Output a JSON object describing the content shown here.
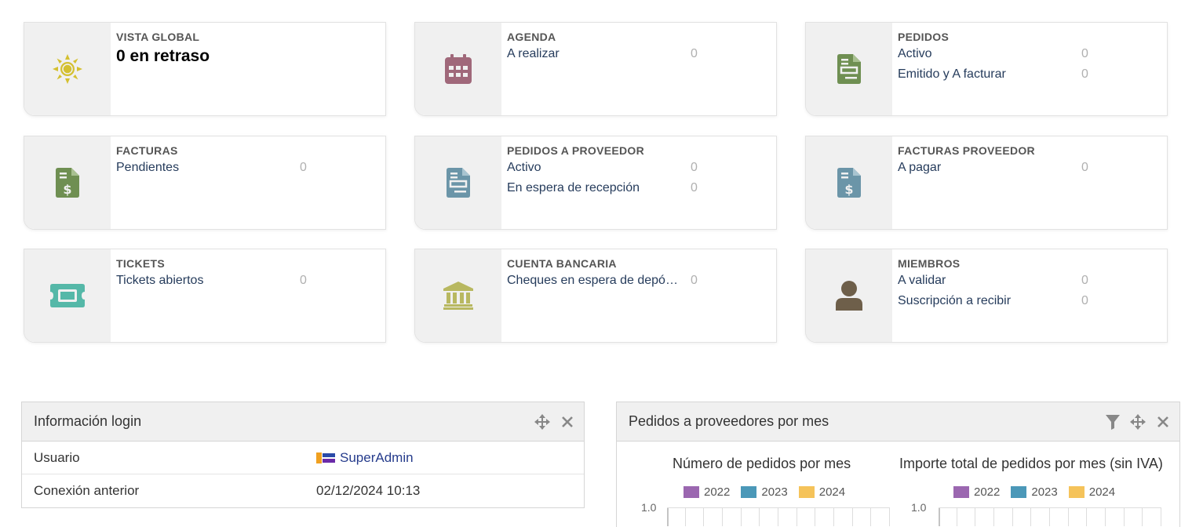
{
  "boxes": [
    {
      "title": "VISTA GLOBAL",
      "big": "0 en retraso",
      "icon": "sun-icon",
      "color": "#d4c030",
      "lines": []
    },
    {
      "title": "AGENDA",
      "icon": "calendar-icon",
      "color": "#a0687a",
      "lines": [
        {
          "label": "A realizar",
          "value": "0"
        }
      ]
    },
    {
      "title": "PEDIDOS",
      "icon": "order-document-icon",
      "color": "#6f8f52",
      "lines": [
        {
          "label": "Activo",
          "value": "0"
        },
        {
          "label": "Emitido y A facturar",
          "value": "0"
        }
      ]
    },
    {
      "title": "FACTURAS",
      "icon": "invoice-dollar-icon",
      "color": "#6f8f52",
      "lines": [
        {
          "label": "Pendientes",
          "value": "0"
        }
      ]
    },
    {
      "title": "PEDIDOS A PROVEEDOR",
      "icon": "supplier-order-document-icon",
      "color": "#6b95a8",
      "lines": [
        {
          "label": "Activo",
          "value": "0"
        },
        {
          "label": "En espera de recepción",
          "value": "0"
        }
      ]
    },
    {
      "title": "FACTURAS PROVEEDOR",
      "icon": "supplier-invoice-dollar-icon",
      "color": "#6b95a8",
      "lines": [
        {
          "label": "A pagar",
          "value": "0"
        }
      ]
    },
    {
      "title": "TICKETS",
      "icon": "ticket-icon",
      "color": "#55b8a8",
      "lines": [
        {
          "label": "Tickets abiertos",
          "value": "0"
        }
      ]
    },
    {
      "title": "CUENTA BANCARIA",
      "icon": "bank-icon",
      "color": "#b8b860",
      "lines": [
        {
          "label": "Cheques en espera de depósito",
          "value": "0"
        }
      ]
    },
    {
      "title": "MIEMBROS",
      "icon": "member-user-icon",
      "color": "#6e5f4a",
      "lines": [
        {
          "label": "A validar",
          "value": "0"
        },
        {
          "label": "Suscripción a recibir",
          "value": "0"
        }
      ]
    }
  ],
  "login_panel": {
    "title": "Información login",
    "rows": [
      {
        "key": "Usuario",
        "value": "SuperAdmin"
      },
      {
        "key": "Conexión anterior",
        "value": "02/12/2024 10:13"
      }
    ]
  },
  "orders_panel": {
    "title": "Pedidos a proveedores por mes"
  },
  "chart_data": [
    {
      "type": "bar",
      "title": "Número de pedidos por mes",
      "series": [
        {
          "name": "2022",
          "values": [],
          "color": "#9b67b0"
        },
        {
          "name": "2023",
          "values": [],
          "color": "#4b98b8"
        },
        {
          "name": "2024",
          "values": [],
          "color": "#f5c35a"
        }
      ],
      "ytick_top": "1.0",
      "grid": true
    },
    {
      "type": "bar",
      "title": "Importe total de pedidos por mes (sin IVA)",
      "series": [
        {
          "name": "2022",
          "values": [],
          "color": "#9b67b0"
        },
        {
          "name": "2023",
          "values": [],
          "color": "#4b98b8"
        },
        {
          "name": "2024",
          "values": [],
          "color": "#f5c35a"
        }
      ],
      "ytick_top": "1.0",
      "grid": true
    }
  ]
}
